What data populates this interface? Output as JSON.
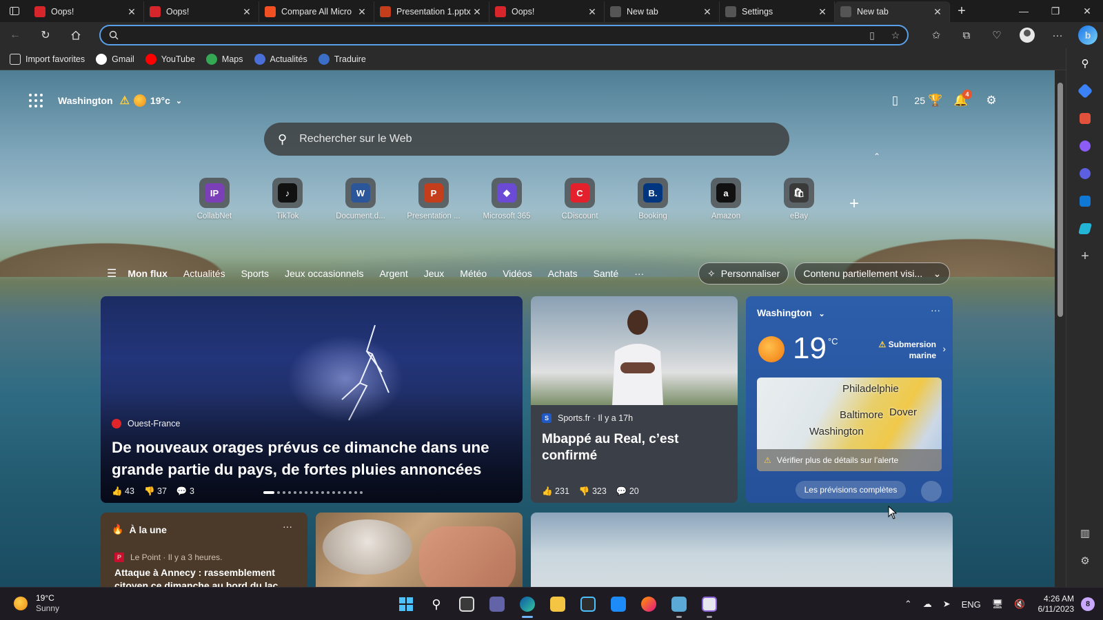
{
  "tabs": [
    {
      "title": "Oops!",
      "favicon": "acrobat-icon",
      "color": "#d7262b"
    },
    {
      "title": "Oops!",
      "favicon": "acrobat-icon",
      "color": "#d7262b"
    },
    {
      "title": "Compare All Micro",
      "favicon": "microsoft-icon",
      "color": "#f25022"
    },
    {
      "title": "Presentation 1.pptx",
      "favicon": "powerpoint-icon",
      "color": "#c43e1c"
    },
    {
      "title": "Oops!",
      "favicon": "acrobat-icon",
      "color": "#d7262b"
    },
    {
      "title": "New tab",
      "favicon": "newtab-icon",
      "color": "#555555"
    },
    {
      "title": "Settings",
      "favicon": "gear-icon",
      "color": "#555555"
    },
    {
      "title": "New tab",
      "favicon": "newtab-icon",
      "color": "#555555",
      "active": true
    }
  ],
  "address": {
    "value": "",
    "placeholder": ""
  },
  "favorites": [
    {
      "label": "Import favorites",
      "icon": "import-icon"
    },
    {
      "label": "Gmail",
      "icon": "google-icon"
    },
    {
      "label": "YouTube",
      "icon": "youtube-icon"
    },
    {
      "label": "Maps",
      "icon": "maps-pin-icon"
    },
    {
      "label": "Actualités",
      "icon": "news-icon"
    },
    {
      "label": "Traduire",
      "icon": "translate-icon"
    }
  ],
  "newtab": {
    "location": "Washington",
    "temp_short": "19°c",
    "rewards_points": "25",
    "notification_count": "4",
    "search_placeholder": "Rechercher sur le Web"
  },
  "quicklinks": [
    {
      "label": "CollabNet",
      "logo": "IP",
      "color": "#7b3fb8"
    },
    {
      "label": "TikTok",
      "logo": "♪",
      "color": "#111111"
    },
    {
      "label": "Document.d...",
      "logo": "W",
      "color": "#2b579a"
    },
    {
      "label": "Presentation ...",
      "logo": "P",
      "color": "#c43e1c"
    },
    {
      "label": "Microsoft 365",
      "logo": "◆",
      "color": "#6b4bd6"
    },
    {
      "label": "CDiscount",
      "logo": "C",
      "color": "#e4202d"
    },
    {
      "label": "Booking",
      "logo": "B.",
      "color": "#003580"
    },
    {
      "label": "Amazon",
      "logo": "a",
      "color": "#111111"
    },
    {
      "label": "eBay",
      "logo": "🛍",
      "color": "#3a3a3a"
    }
  ],
  "feednav": {
    "items": [
      "Mon flux",
      "Actualités",
      "Sports",
      "Jeux occasionnels",
      "Argent",
      "Jeux",
      "Météo",
      "Vidéos",
      "Achats",
      "Santé"
    ],
    "more": "···",
    "personalize": "Personnaliser",
    "content_mode": "Contenu partiellement visi..."
  },
  "hero": {
    "source": "Ouest-France",
    "headline": "De nouveaux orages prévus ce dimanche dans une grande partie du pays, de fortes pluies annoncées",
    "likes": "43",
    "dislikes": "37",
    "comments": "3"
  },
  "sport": {
    "source": "Sports.fr · Il y a 17h",
    "headline": "Mbappé au Real, c’est confirmé",
    "likes": "231",
    "dislikes": "323",
    "comments": "20"
  },
  "weather": {
    "location": "Washington",
    "temp": "19",
    "unit": "°C",
    "alert": "Submersion marine",
    "map_cities": [
      "Philadelphie",
      "Baltimore",
      "Dover",
      "Washington"
    ],
    "map_note": "Vérifier plus de détails sur l'alerte",
    "forecast_button": "Les prévisions complètes"
  },
  "alaune": {
    "title": "À la une",
    "source": "Le Point · Il y a 3 heures.",
    "headline": "Attaque à Annecy : rassemblement citoyen ce dimanche au bord du lac"
  },
  "taskbar": {
    "weather_temp": "19°C",
    "weather_desc": "Sunny",
    "lang": "ENG",
    "time": "4:26 AM",
    "date": "6/11/2023",
    "notif_count": "8"
  }
}
